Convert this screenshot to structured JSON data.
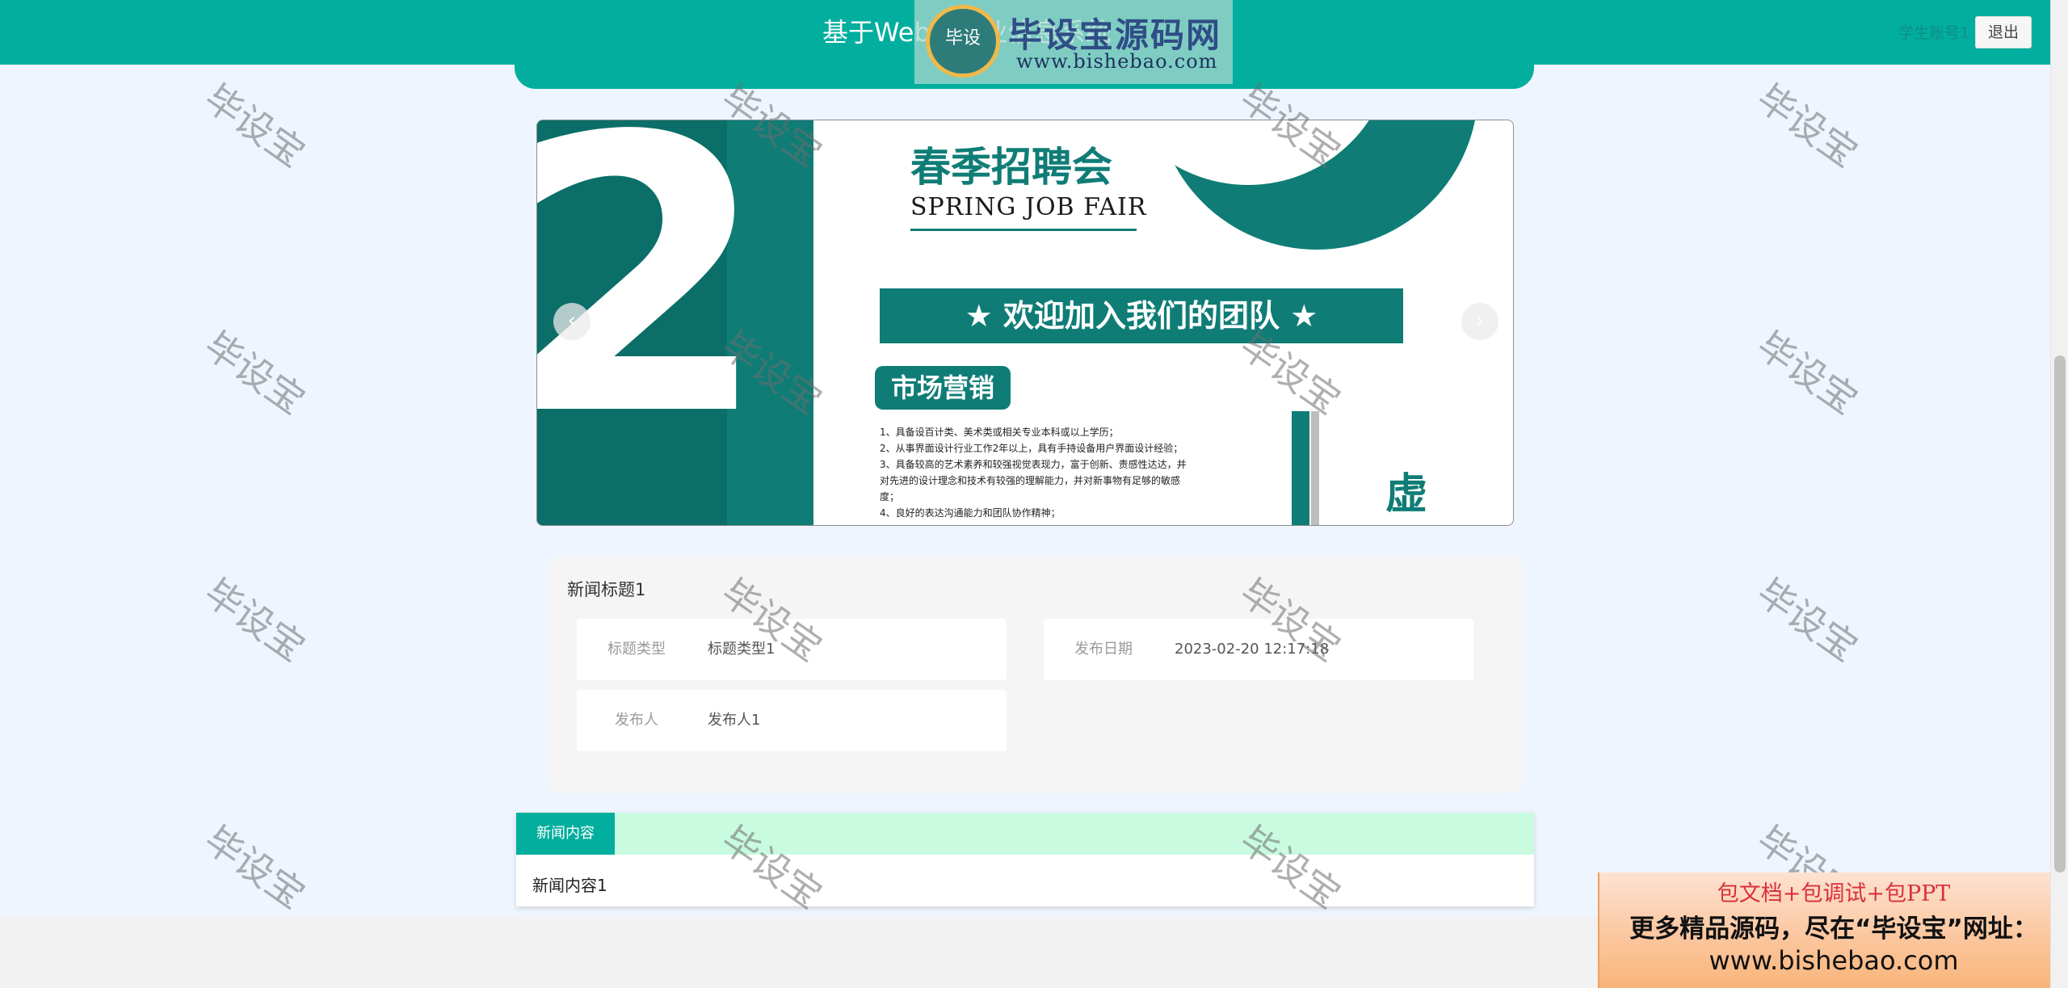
{
  "header": {
    "site_title": "基于Web的就业信息系统",
    "user_link": "学生账号1",
    "logout_label": "退出"
  },
  "logo": {
    "mark_text": "毕设",
    "name": "毕设宝源码网",
    "url": "www.bishebao.com"
  },
  "carousel": {
    "prev_label": "‹",
    "next_label": "›",
    "slide": {
      "big_digit": "2",
      "title": "春季招聘会",
      "subtitle": "SPRING JOB FAIR",
      "banner": "★ 欢迎加入我们的团队 ★",
      "tag": "市场营销",
      "char": "虚",
      "lines": [
        "1、具备设百计类、美术类或相关专业本科或以上学历；",
        "2、从事界面设计行业工作2年以上，具有手持设备用户界面设计经验；",
        "3、具备较高的艺术素养和较强视觉表现力，富于创新、责感性达达，并",
        "对先进的设计理念和技术有较强的理解能力，并对新事物有足够的敏感",
        "度；",
        "4、良好的表达沟通能力和团队协作精神；"
      ]
    }
  },
  "detail": {
    "title": "新闻标题1",
    "fields": {
      "type_label": "标题类型",
      "type_value": "标题类型1",
      "date_label": "发布日期",
      "date_value": "2023-02-20 12:17:18",
      "publisher_label": "发布人",
      "publisher_value": "发布人1"
    }
  },
  "content": {
    "tab_label": "新闻内容",
    "text": "新闻内容1"
  },
  "watermark_text": "毕设宝",
  "promo": {
    "line1": "包文档+包调试+包PPT",
    "line2": "更多精品源码，尽在“毕设宝”网址：",
    "line3": "www.bishebao.com"
  },
  "colors": {
    "brand": "#02ae9e",
    "page_background": "#eef5fe",
    "tab_bar": "#c9fbe0",
    "promo_red": "#d9303b"
  }
}
